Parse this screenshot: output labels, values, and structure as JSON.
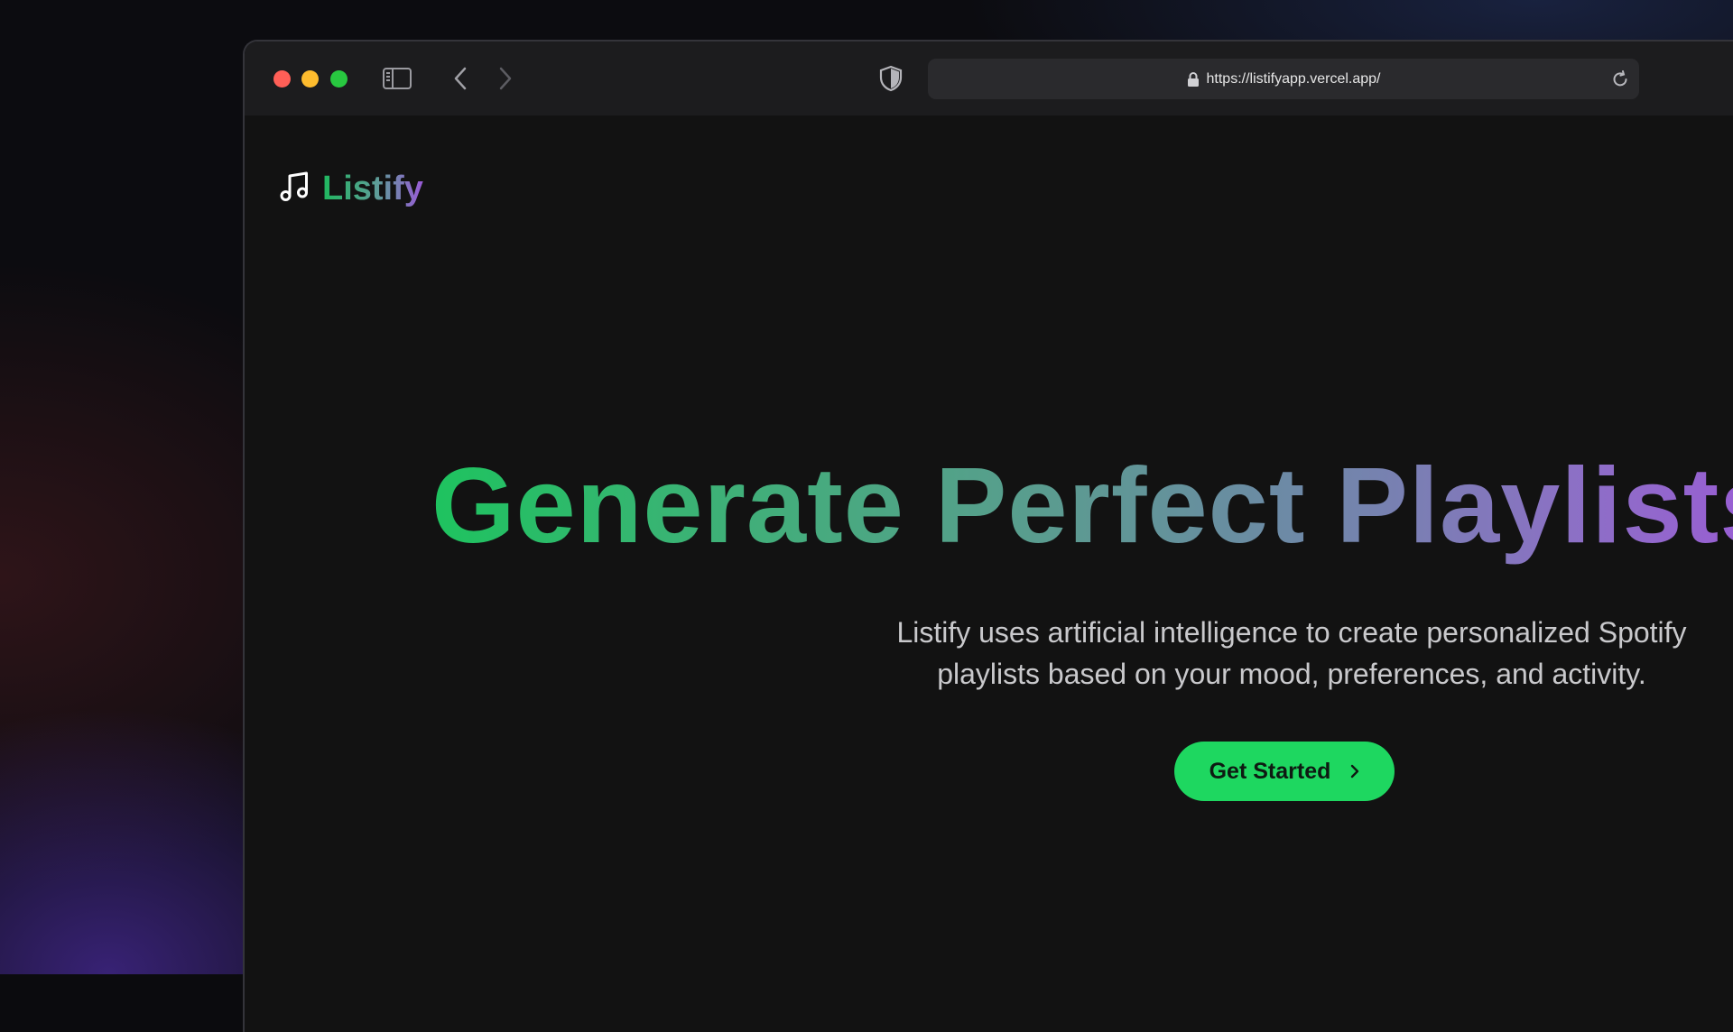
{
  "browser": {
    "url": "https://listifyapp.vercel.app/",
    "icons": {
      "sidebar_toggle": "sidebar-icon",
      "back": "chevron-left-icon",
      "forward": "chevron-right-icon",
      "privacy": "shield-icon",
      "lock": "lock-icon",
      "reload": "reload-icon"
    }
  },
  "brand": {
    "name": "Listify",
    "icon": "music-note-icon"
  },
  "hero": {
    "headline": "Generate Perfect Playlists",
    "description": "Listify uses artificial intelligence to create personalized Spotify playlists based on your mood, preferences, and activity.",
    "cta_label": "Get Started",
    "cta_icon": "chevron-right-icon"
  },
  "colors": {
    "accent": "#1ed760",
    "gradient_start": "#1ec35f",
    "gradient_end": "#9b5ad6",
    "window_background": "#121212",
    "toolbar_background": "#1c1c1e"
  }
}
